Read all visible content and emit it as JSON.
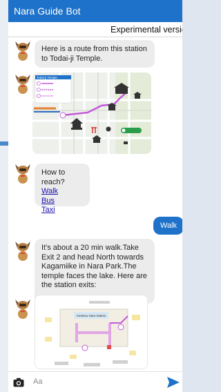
{
  "app": {
    "title": "Nara Guide Bot",
    "subtitle": "Experimental versio"
  },
  "messages": {
    "m1": "Here is a route from this station to Todai-ji Temple.",
    "map_title": "Todai-ji Temple",
    "reach_prompt": "How to reach?",
    "options": [
      "Walk",
      "Bus",
      "Taxi"
    ],
    "user_reply": "Walk",
    "walk_info": "It's about a 20 min walk.Take Exit 2 and head North towards Kagamiike in Nara Park.The temple faces the lake. Here are the station exits:",
    "station_label": "Kintetsu Nara Station"
  },
  "composer": {
    "placeholder": "Aa"
  },
  "colors": {
    "header": "#1f72c9",
    "bubble_bot": "#ececec",
    "bubble_user": "#1f72c9",
    "route": "#c35ad8"
  },
  "icons": [
    "bot-avatar-icon",
    "camera-icon",
    "send-icon",
    "pointer-arrow-icon"
  ]
}
